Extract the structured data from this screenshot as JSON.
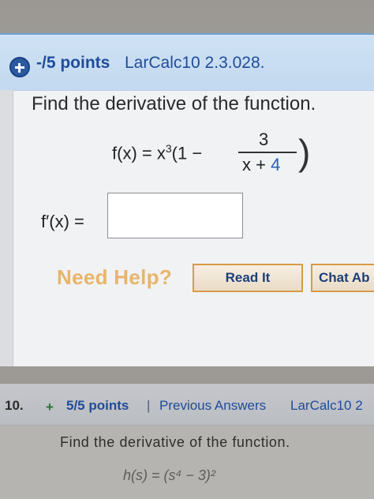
{
  "problem9": {
    "points": "-/5 points",
    "course_code": "LarCalc10 2.3.028.",
    "prompt": "Find the derivative of the function.",
    "function_lhs": "f(x) = x",
    "exponent": "3",
    "paren_open": "(1 −",
    "fraction_numerator": "3",
    "fraction_denominator_prefix": "x + ",
    "fraction_denominator_const": "4",
    "paren_close": ")",
    "answer_label": "f′(x) =",
    "answer_value": "",
    "need_help_label": "Need Help?",
    "read_it_label": "Read It",
    "chat_label": "Chat Ab"
  },
  "problem10": {
    "number": "10.",
    "points": "5/5 points",
    "separator": "|",
    "previous_answers_label": "Previous Answers",
    "course_code": "LarCalc10 2",
    "prompt": "Find the derivative of the function.",
    "function": "h(s) = (s⁴ − 3)²"
  },
  "colors": {
    "link_blue": "#1f4c9a",
    "help_orange": "#e8b56a",
    "button_border": "#d79b44"
  }
}
